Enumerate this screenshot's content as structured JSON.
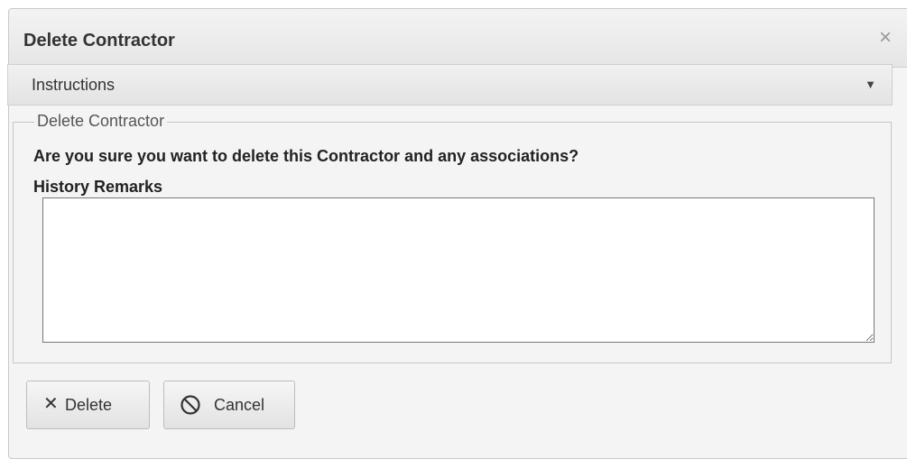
{
  "dialog": {
    "title": "Delete Contractor",
    "close_glyph": "×"
  },
  "instructions": {
    "label": "Instructions",
    "toggle_glyph": "▼"
  },
  "form": {
    "legend": "Delete Contractor",
    "question": "Are you sure you want to delete this Contractor and any associations?",
    "remarks_label": "History Remarks",
    "remarks_value": "",
    "remarks_placeholder": ""
  },
  "buttons": {
    "delete": {
      "label": "Delete",
      "icon": "close-icon",
      "glyph": "✕"
    },
    "cancel": {
      "label": "Cancel",
      "icon": "ban-icon"
    }
  },
  "colors": {
    "dialog_bg": "#f4f4f4",
    "title_text": "#333333",
    "border": "#c9c9c9"
  }
}
